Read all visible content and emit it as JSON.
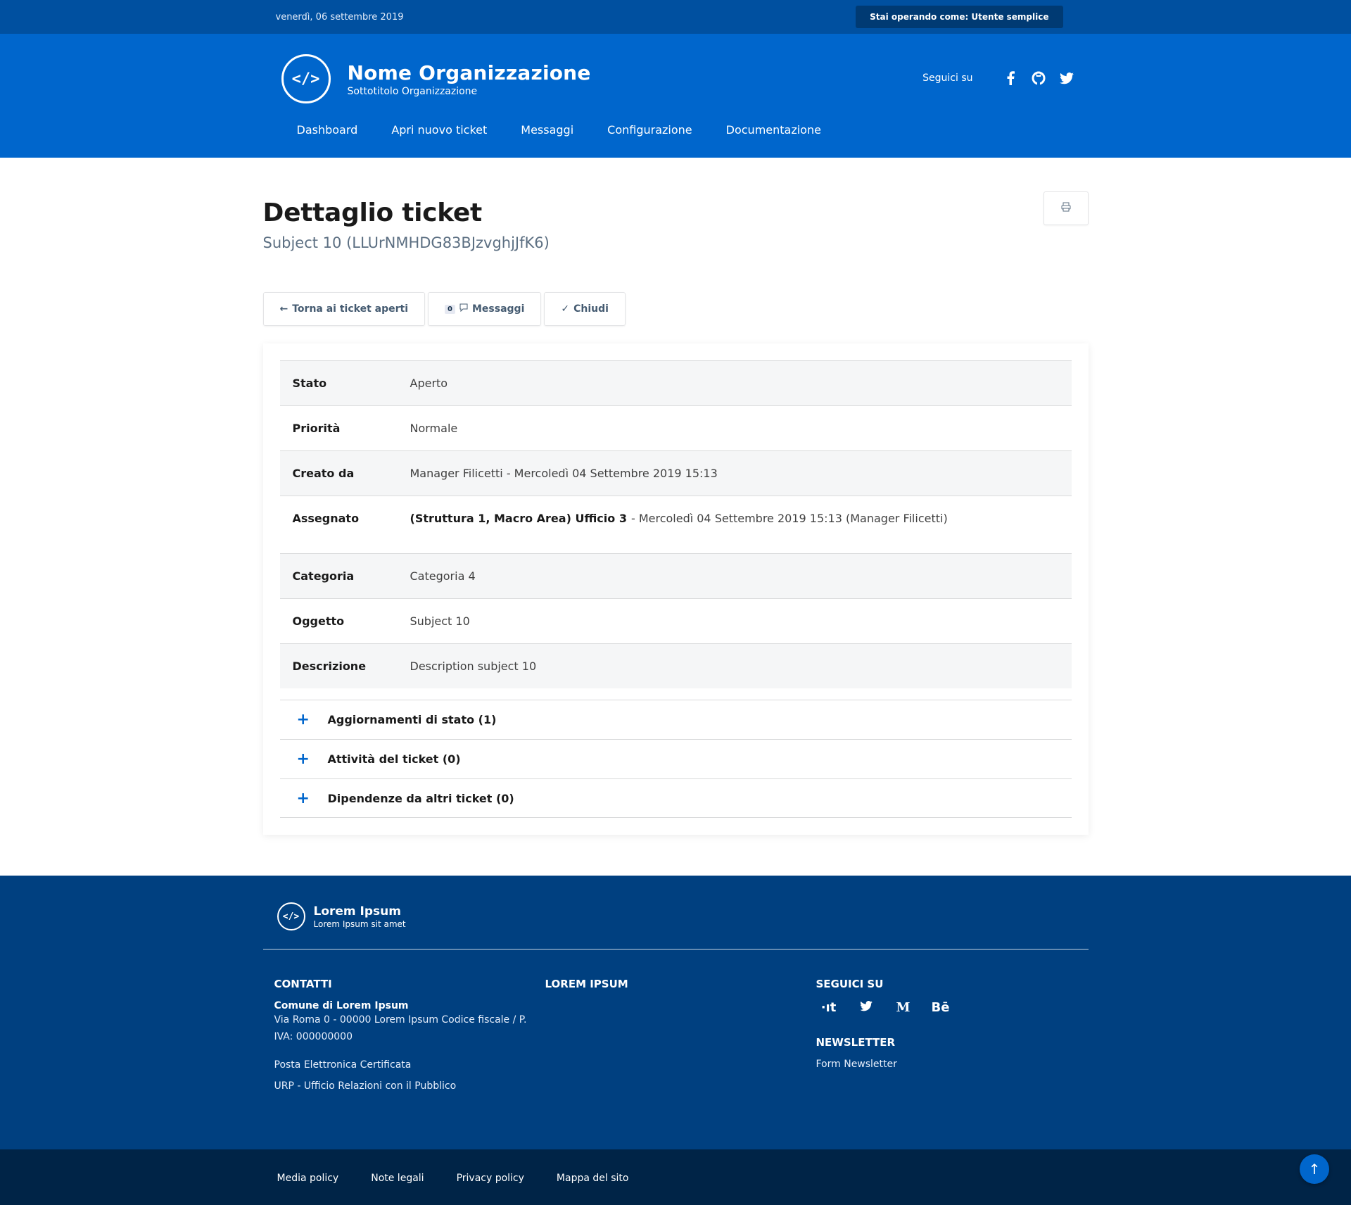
{
  "slim": {
    "date": "venerdì, 06 settembre 2019",
    "user": "Stai operando come: Utente semplice"
  },
  "brand": {
    "logo": "</>",
    "name": "Nome Organizzazione",
    "subtitle": "Sottotitolo Organizzazione"
  },
  "social": {
    "label": "Seguici su",
    "icons": [
      "facebook-icon",
      "github-icon",
      "twitter-icon"
    ]
  },
  "nav": [
    "Dashboard",
    "Apri nuovo ticket",
    "Messaggi",
    "Configurazione",
    "Documentazione"
  ],
  "page": {
    "title": "Dettaglio ticket",
    "subtitle": "Subject 10 (LLUrNMHDG83BJzvghjJfK6)",
    "print_icon": "printer-icon"
  },
  "actions": {
    "back": "Torna ai ticket aperti",
    "messages_count": "0",
    "messages": "Messaggi",
    "close": "Chiudi"
  },
  "details": [
    {
      "key": "Stato",
      "value": "Aperto"
    },
    {
      "key": "Priorità",
      "value": "Normale"
    },
    {
      "key": "Creato da",
      "value": "Manager Filicetti - Mercoledì 04 Settembre 2019 15:13"
    },
    {
      "key": "Assegnato",
      "value_bold": "(Struttura 1, Macro Area) Ufficio 3",
      "value": "- Mercoledì 04 Settembre 2019 15:13 (Manager Filicetti)"
    },
    {
      "key": "Categoria",
      "value": "Categoria 4"
    },
    {
      "key": "Oggetto",
      "value": "Subject 10"
    },
    {
      "key": "Descrizione",
      "value": "Description subject 10"
    }
  ],
  "accordion": [
    "Aggiornamenti di stato (1)",
    "Attività del ticket (0)",
    "Dipendenze da altri ticket (0)"
  ],
  "footer": {
    "brand_name": "Lorem Ipsum",
    "brand_sub": "Lorem Ipsum sit amet",
    "contacts_title": "CONTATTI",
    "contacts_org": "Comune di Lorem Ipsum",
    "contacts_address": "Via Roma 0 - 00000 Lorem Ipsum Codice fiscale / P. IVA: 000000000",
    "contacts_pec": "Posta Elettronica Certificata",
    "contacts_urp": "URP - Ufficio Relazioni con il Pubblico",
    "lorem_title": "LOREM IPSUM",
    "follow_title": "SEGUICI SU",
    "newsletter_title": "NEWSLETTER",
    "newsletter_link": "Form Newsletter"
  },
  "bottom_links": [
    "Media policy",
    "Note legali",
    "Privacy policy",
    "Mappa del sito"
  ],
  "colors": {
    "primary": "#0066cc",
    "slim": "#0050a0",
    "footer": "#004080",
    "footer_bottom": "#002447"
  }
}
